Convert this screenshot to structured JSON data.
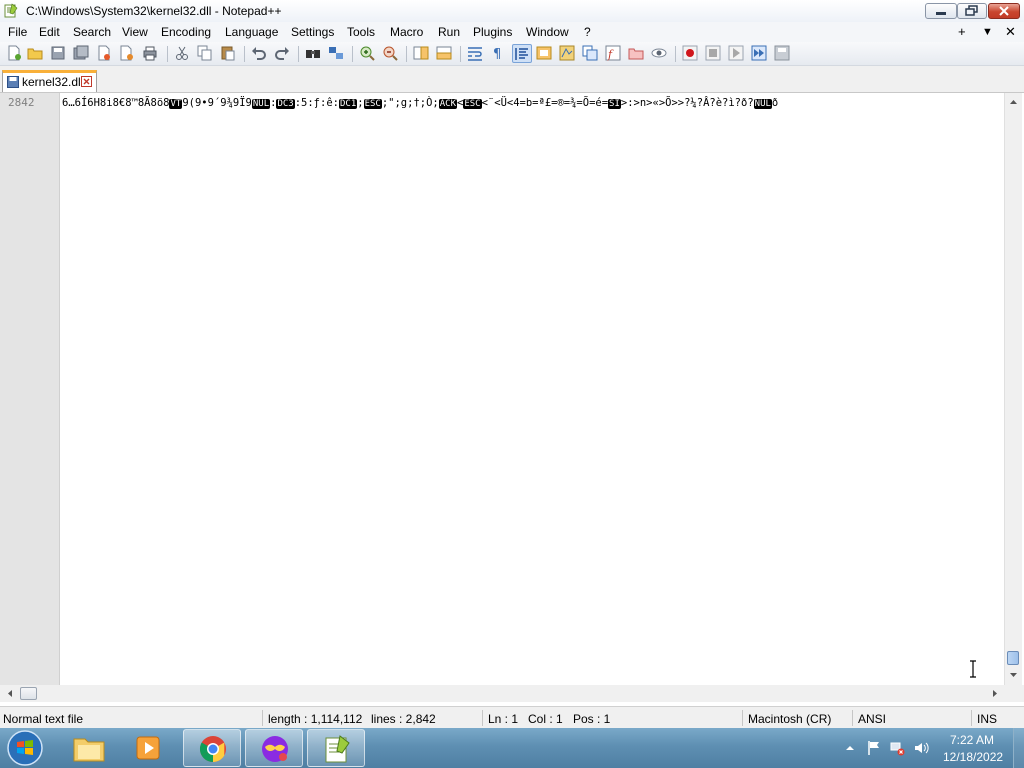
{
  "window": {
    "title": "C:\\Windows\\System32\\kernel32.dll - Notepad++"
  },
  "menu": {
    "items": [
      "File",
      "Edit",
      "Search",
      "View",
      "Encoding",
      "Language",
      "Settings",
      "Tools",
      "Macro",
      "Run",
      "Plugins",
      "Window",
      "?"
    ],
    "right_plus": "+",
    "right_arrow": "▼",
    "right_close": "✕"
  },
  "tab": {
    "label": "kernel32.dll"
  },
  "editor": {
    "line_number": "2842",
    "segments": [
      {
        "t": "6…6Í6H8i8€8™8Ã8ö8"
      },
      {
        "t": "VT",
        "ctl": true
      },
      {
        "t": "9(9•9´9¾9Ï9"
      },
      {
        "t": "NUL",
        "ctl": true
      },
      {
        "t": ":"
      },
      {
        "t": "DC3",
        "ctl": true
      },
      {
        "t": ":5:ƒ:ê:"
      },
      {
        "t": "DC1",
        "ctl": true
      },
      {
        "t": ";"
      },
      {
        "t": "ESC",
        "ctl": true
      },
      {
        "t": ";\";g;†;Ò;"
      },
      {
        "t": "ACK",
        "ctl": true
      },
      {
        "t": "<"
      },
      {
        "t": "ESC",
        "ctl": true
      },
      {
        "t": "<¨<Ü<4=b=ª£=®=¾=Õ=é="
      },
      {
        "t": "SI",
        "ctl": true
      },
      {
        "t": ">:>n>«>Õ>>?¼?Â?è?ì?ð?"
      },
      {
        "t": "NUL",
        "ctl": true
      },
      {
        "t": "ð"
      }
    ]
  },
  "status": {
    "file_type": "Normal text file",
    "length": "length : 1,114,112",
    "lines": "lines : 2,842",
    "ln": "Ln : 1",
    "col": "Col : 1",
    "pos": "Pos : 1",
    "eol": "Macintosh (CR)",
    "encoding": "ANSI",
    "mode": "INS"
  },
  "taskbar": {
    "time": "7:22 AM",
    "date": "12/18/2022",
    "apps": [
      "explorer",
      "media-player",
      "chrome",
      "app-mask",
      "notepad++"
    ]
  },
  "colors": {
    "tab_accent": "#f9b039",
    "gutter": "#e4e4e4",
    "control_char_bg": "#000000"
  }
}
